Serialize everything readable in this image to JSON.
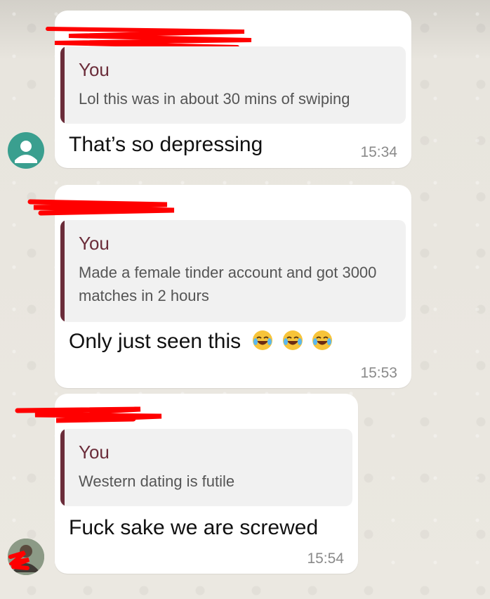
{
  "conversation": {
    "messages": [
      {
        "quoted_author": "You",
        "quoted_text": "Lol this was in about 30 mins of swiping",
        "text": "That’s so depressing",
        "time": "15:34"
      },
      {
        "quoted_author": "You",
        "quoted_text": "Made a female tinder account and got 3000 matches in 2 hours",
        "text": "Only just seen this",
        "emoji": "😂😂😂",
        "time": "15:53"
      },
      {
        "quoted_author": "You",
        "quoted_text": "Western dating is futile",
        "text": "Fuck sake we are screwed",
        "time": "15:54"
      }
    ]
  },
  "colors": {
    "quote_accent": "#6b2d3a",
    "redaction": "#ff0000",
    "avatar_default": "#3a9f8f"
  },
  "icons": {
    "avatar_1": "default-person-avatar",
    "avatar_3": "photo-avatar-redacted",
    "emoji": "face-with-tears-of-joy"
  }
}
